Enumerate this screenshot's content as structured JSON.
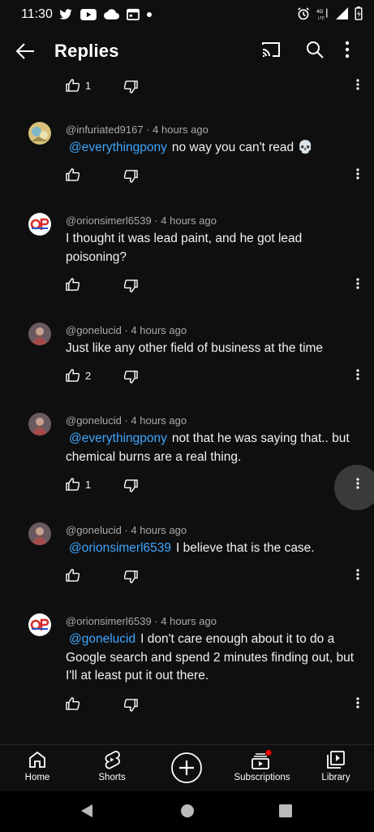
{
  "status": {
    "time": "11:30"
  },
  "header": {
    "title": "Replies"
  },
  "comments": [
    {
      "likes": "1"
    },
    {
      "author": "@infuriated9167",
      "time": "4 hours ago",
      "mention": "@everythingpony",
      "text": "no way you can't read 💀",
      "likes": ""
    },
    {
      "author": "@orionsimerl6539",
      "time": "4 hours ago",
      "text": "I thought it was lead paint, and he got lead poisoning?",
      "likes": ""
    },
    {
      "author": "@gonelucid",
      "time": "4 hours ago",
      "text": "Just like any other field of business at the time",
      "likes": "2"
    },
    {
      "author": "@gonelucid",
      "time": "4 hours ago",
      "mention": "@everythingpony",
      "text": "not that he was saying that.. but chemical burns are a real thing.",
      "likes": "1"
    },
    {
      "author": "@gonelucid",
      "time": "4 hours ago",
      "mention": "@orionsimerl6539",
      "text": "I believe that is the case.",
      "likes": ""
    },
    {
      "author": "@orionsimerl6539",
      "time": "4 hours ago",
      "mention": "@gonelucid",
      "text": "I don't care enough about it to do a Google search and spend 2 minutes finding out, but I'll at least put it out there.",
      "likes": ""
    }
  ],
  "nav": {
    "home": "Home",
    "shorts": "Shorts",
    "subscriptions": "Subscriptions",
    "library": "Library"
  },
  "colors": {
    "background": "#0f0f0f",
    "mention": "#3ea6ff",
    "meta": "#aaaaaa",
    "notification": "#ff0000"
  }
}
